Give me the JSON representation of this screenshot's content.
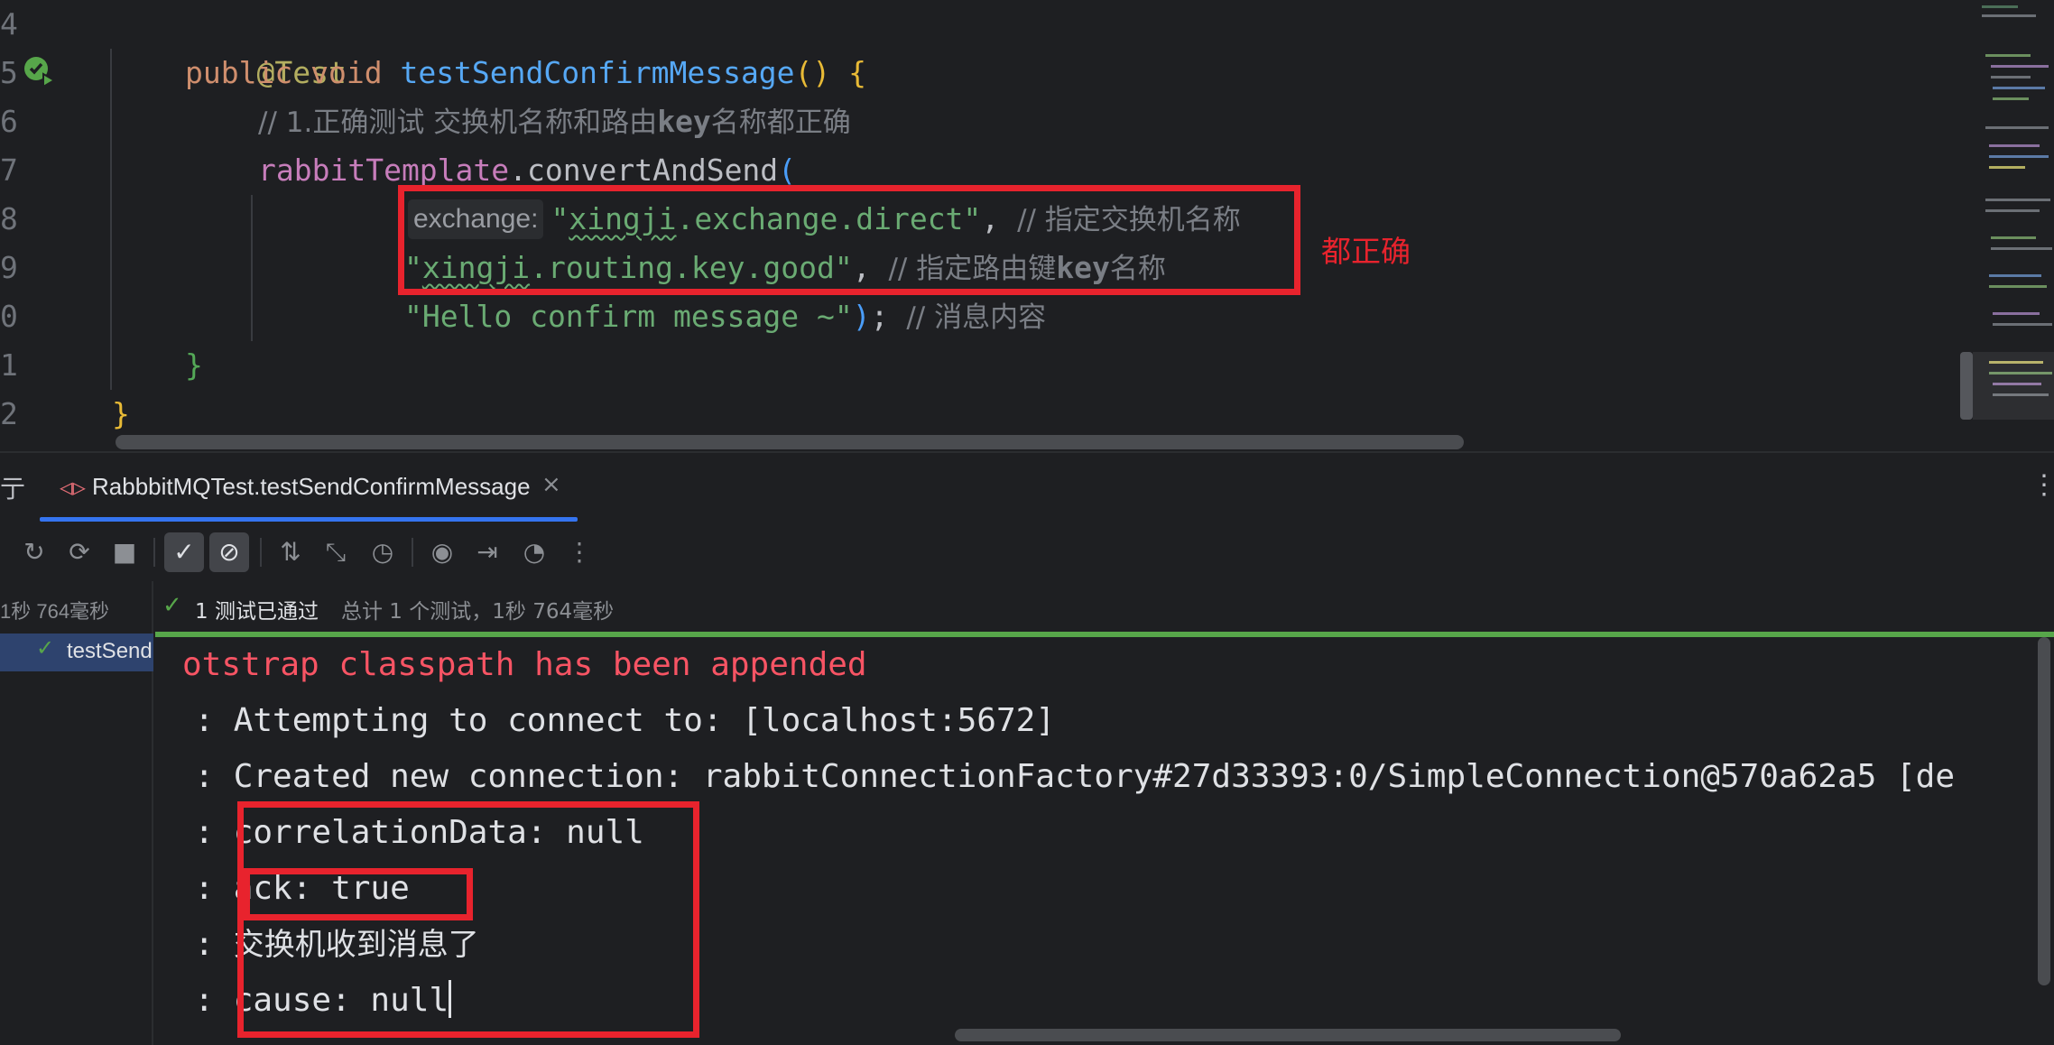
{
  "editor": {
    "line_numbers": [
      "4",
      "5",
      "6",
      "7",
      "8",
      "9",
      "0",
      "1",
      "2"
    ],
    "annotation": "@Test",
    "kw_public": "public",
    "kw_void": "void",
    "method_name": "testSendConfirmMessage",
    "method_tail": "() {",
    "comment1": "// 1.正确测试 交换机名称和路由",
    "comment1_key": "key",
    "comment1_tail": "名称都正确",
    "template_field": "rabbitTemplate",
    "method_call": ".convertAndSend",
    "open_paren": "(",
    "param_hint": "exchange:",
    "exchange_q1": "\"",
    "exchange_word": "xingji",
    "exchange_rest": ".exchange.direct\"",
    "comma": ", ",
    "comment2": "// 指定交换机名称",
    "routing_q1": "\"",
    "routing_word": "xingji",
    "routing_rest": ".routing.key.good\"",
    "comment3_a": "// 指定路由键",
    "comment3_key": "key",
    "comment3_b": "名称",
    "message_str": "\"Hello confirm message ~\"",
    "close_paren": ")",
    "semicolon": "; ",
    "comment4": "// 消息内容",
    "close_brace_inner": "}",
    "close_brace_outer": "}",
    "annotation_note": "都正确"
  },
  "run_panel": {
    "run_label": "亍",
    "tab_title": "RabbbitMQTest.testSendConfirmMessage",
    "tab_close": "×",
    "more_menu": "⋮",
    "toolbar": {
      "rerun": "↻",
      "rerun_failed": "⟳",
      "stop": "■",
      "show_passed": "✓",
      "show_ignored": "⊘",
      "sort": "⇅",
      "collapse": "⤡",
      "history": "◷",
      "snapshot": "◉",
      "export": "⇥",
      "coverage": "◔",
      "more": "⋮"
    },
    "tree": {
      "duration": "1秒 764毫秒",
      "test_name": "testSend",
      "check": "✓"
    },
    "status": {
      "check": "✓",
      "passed": "1 测试已通过",
      "summary": "总计 1 个测试，1秒 764毫秒"
    },
    "console": [
      {
        "prefix": "",
        "text": "otstrap classpath has been appended",
        "error": true
      },
      {
        "prefix": "  : ",
        "text": "Attempting to connect to: [localhost:5672]",
        "error": false
      },
      {
        "prefix": "  : ",
        "text": "Created new connection: rabbitConnectionFactory#27d33393:0/SimpleConnection@570a62a5 [de",
        "error": false
      },
      {
        "prefix": "  : ",
        "text": "correlationData: null",
        "error": false
      },
      {
        "prefix": "  : ",
        "text": "ack: true",
        "error": false
      },
      {
        "prefix": "  : ",
        "text": "交换机收到消息了",
        "error": false
      },
      {
        "prefix": "  : ",
        "text": "cause: null",
        "error": false
      }
    ]
  },
  "colors": {
    "highlight_box": "#e8232d",
    "pass_green": "#57a64a",
    "tab_accent": "#3574f0",
    "error_text": "#f75464"
  }
}
